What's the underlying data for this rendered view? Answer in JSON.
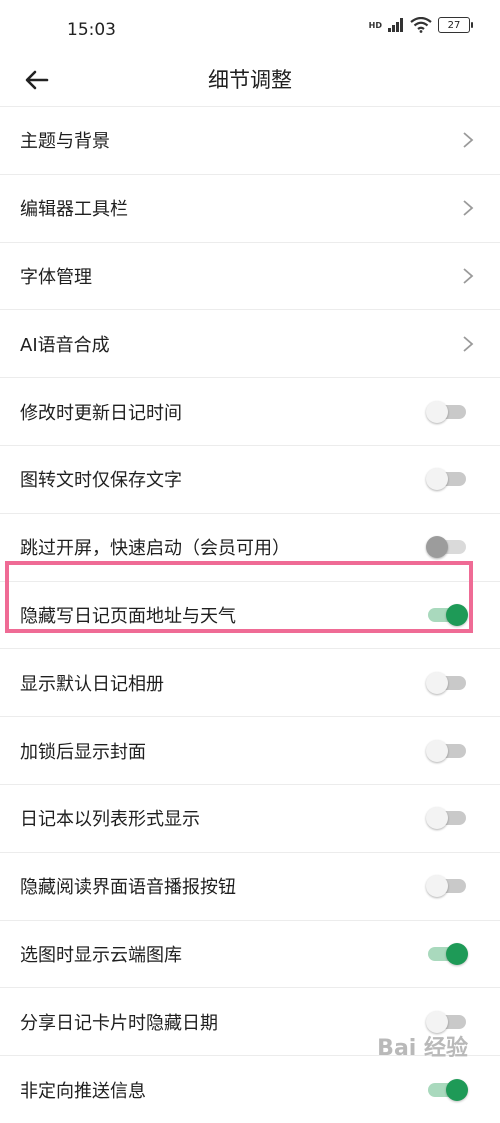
{
  "status": {
    "time": "15:03",
    "battery": "27",
    "network": "HD"
  },
  "header": {
    "title": "细节调整"
  },
  "items": [
    {
      "label": "主题与背景",
      "type": "nav"
    },
    {
      "label": "编辑器工具栏",
      "type": "nav"
    },
    {
      "label": "字体管理",
      "type": "nav"
    },
    {
      "label": "AI语音合成",
      "type": "nav"
    },
    {
      "label": "修改时更新日记时间",
      "type": "toggle",
      "on": false
    },
    {
      "label": "图转文时仅保存文字",
      "type": "toggle",
      "on": false
    },
    {
      "label": "跳过开屏，快速启动（会员可用）",
      "type": "toggle",
      "on": false,
      "disabled": true
    },
    {
      "label": "隐藏写日记页面地址与天气",
      "type": "toggle",
      "on": true
    },
    {
      "label": "显示默认日记相册",
      "type": "toggle",
      "on": false
    },
    {
      "label": "加锁后显示封面",
      "type": "toggle",
      "on": false
    },
    {
      "label": "日记本以列表形式显示",
      "type": "toggle",
      "on": false
    },
    {
      "label": "隐藏阅读界面语音播报按钮",
      "type": "toggle",
      "on": false
    },
    {
      "label": "选图时显示云端图库",
      "type": "toggle",
      "on": true
    },
    {
      "label": "分享日记卡片时隐藏日期",
      "type": "toggle",
      "on": false
    },
    {
      "label": "非定向推送信息",
      "type": "toggle",
      "on": true
    }
  ],
  "watermark": "Bai 经验",
  "colors": {
    "toggle_on": "#1e9a57",
    "highlight": "#ef6b95"
  }
}
